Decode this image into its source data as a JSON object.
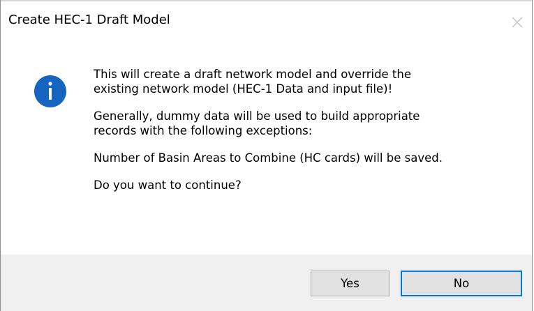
{
  "window": {
    "title": "Create HEC-1 Draft Model",
    "close_icon": "close-icon"
  },
  "message": {
    "icon": "info-icon",
    "icon_color": "#1565c0",
    "paragraph1_line1": "This will create a draft network model and override the",
    "paragraph1_line2": "existing network model (HEC-1 Data and input file)!",
    "paragraph2_line1": "Generally, dummy data will be used to build appropriate",
    "paragraph2_line2": "records with the following exceptions:",
    "paragraph3": "Number of Basin Areas to Combine (HC cards) will be saved.",
    "paragraph4": "Do you want to continue?"
  },
  "buttons": {
    "yes_label": "Yes",
    "no_label": "No",
    "default_button_accent": "#0078d7"
  }
}
